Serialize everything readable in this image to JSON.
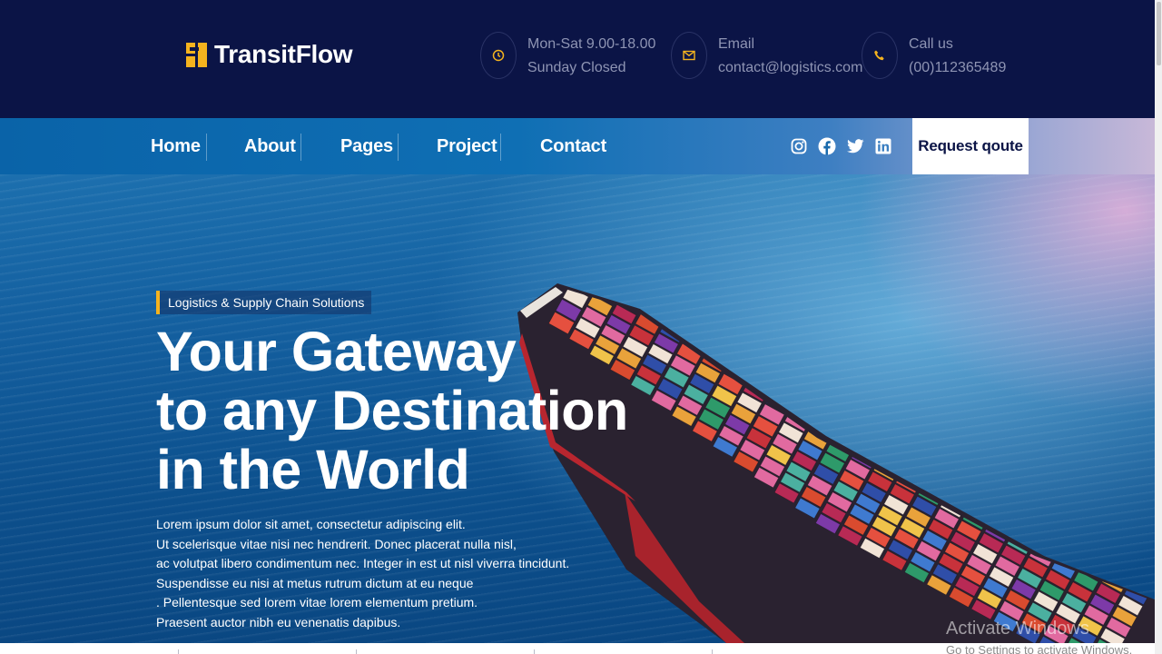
{
  "brand": {
    "name": "TransitFlow",
    "accent": "#f5b31e",
    "navy": "#0b1446"
  },
  "header_info": [
    {
      "icon": "clock-icon",
      "line1": "Mon-Sat 9.00-18.00",
      "line2": "Sunday Closed"
    },
    {
      "icon": "mail-icon",
      "line1": "Email",
      "line2": "contact@logistics.com"
    },
    {
      "icon": "phone-icon",
      "line1": "Call us",
      "line2": "(00)112365489"
    }
  ],
  "nav": {
    "items": [
      "Home",
      "About",
      "Pages",
      "Project",
      "Contact"
    ],
    "social": [
      "instagram-icon",
      "facebook-icon",
      "twitter-icon",
      "linkedin-icon"
    ],
    "cta": "Request qoute"
  },
  "hero": {
    "tag": "Logistics & Supply Chain Solutions",
    "headline": [
      "Your Gateway",
      "to any Destination",
      "in the World"
    ],
    "body": [
      "Lorem ipsum dolor sit amet, consectetur adipiscing elit.",
      "Ut scelerisque vitae nisi nec hendrerit. Donec placerat nulla nisl,",
      "ac volutpat libero condimentum nec. Integer in est ut nisl viverra tincidunt.",
      "Suspendisse eu nisi at metus rutrum dictum at eu neque",
      ". Pellentesque sed lorem vitae lorem elementum pretium.",
      "Praesent auctor nibh eu venenatis dapibus."
    ]
  },
  "os_watermark": {
    "line1": "Activate Windows",
    "line2": "Go to Settings to activate Windows."
  }
}
